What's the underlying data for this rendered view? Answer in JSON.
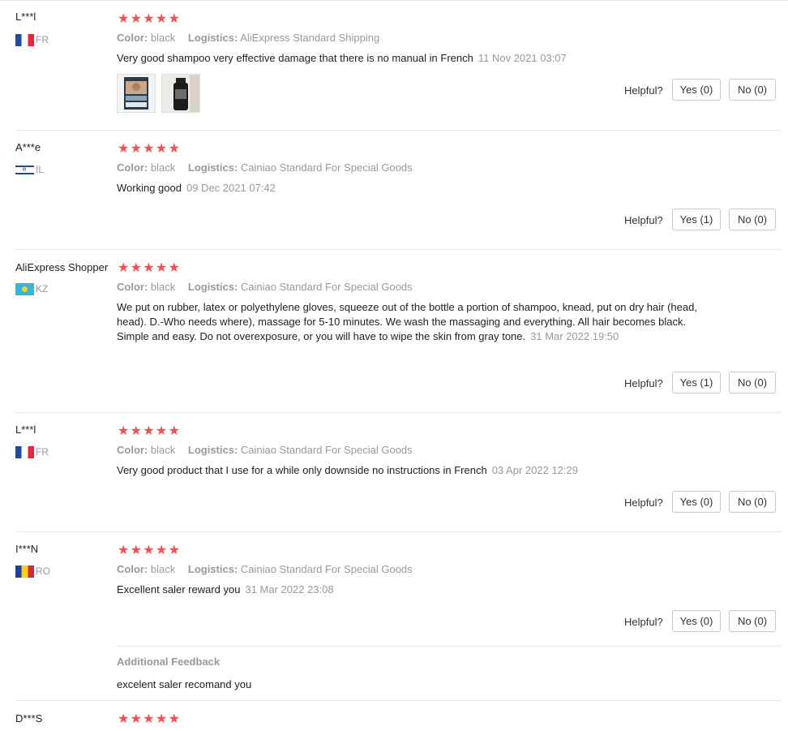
{
  "labels": {
    "color": "Color:",
    "logistics": "Logistics:",
    "helpful": "Helpful?",
    "stars": "★★★★★",
    "additional_feedback": "Additional Feedback"
  },
  "reviews": [
    {
      "user": "L***l",
      "country": "FR",
      "flag": "fr",
      "rating": 5,
      "color": "black",
      "logistics": "AliExpress Standard Shipping",
      "text": "Very good shampoo very effective damage that there is no manual in French",
      "date": "11 Nov 2021 03:07",
      "yes": "Yes (0)",
      "no": "No (0)",
      "photos": [
        "photo-1",
        "photo-2"
      ]
    },
    {
      "user": "A***e",
      "country": "IL",
      "flag": "il",
      "rating": 5,
      "color": "black",
      "logistics": "Cainiao Standard For Special Goods",
      "text": "Working good",
      "date": "09 Dec 2021 07:42",
      "yes": "Yes (1)",
      "no": "No (0)"
    },
    {
      "user": "AliExpress Shopper",
      "country": "KZ",
      "flag": "kz",
      "rating": 5,
      "color": "black",
      "logistics": "Cainiao Standard For Special Goods",
      "text": "We put on rubber, latex or polyethylene gloves, squeeze out of the bottle a portion of shampoo, knead, put on dry hair (head, head). D.-Who needs where), massage for 5-10 minutes. We wash the massaging and everything. All hair becomes black. Simple and easy. Do not overexposure, or you will have to wipe the skin from gray tone.",
      "date": "31 Mar 2022 19:50",
      "yes": "Yes (1)",
      "no": "No (0)"
    },
    {
      "user": "L***l",
      "country": "FR",
      "flag": "fr",
      "rating": 5,
      "color": "black",
      "logistics": "Cainiao Standard For Special Goods",
      "text": "Very good product that I use for a while only downside no instructions in French",
      "date": "03 Apr 2022 12:29",
      "yes": "Yes (0)",
      "no": "No (0)"
    },
    {
      "user": "I***N",
      "country": "RO",
      "flag": "ro",
      "rating": 5,
      "color": "black",
      "logistics": "Cainiao Standard For Special Goods",
      "text": "Excellent saler reward you",
      "date": "31 Mar 2022 23:08",
      "yes": "Yes (0)",
      "no": "No (0)",
      "additional_feedback": "excelent saler recomand you"
    },
    {
      "user": "D***S",
      "rating": 5
    }
  ]
}
